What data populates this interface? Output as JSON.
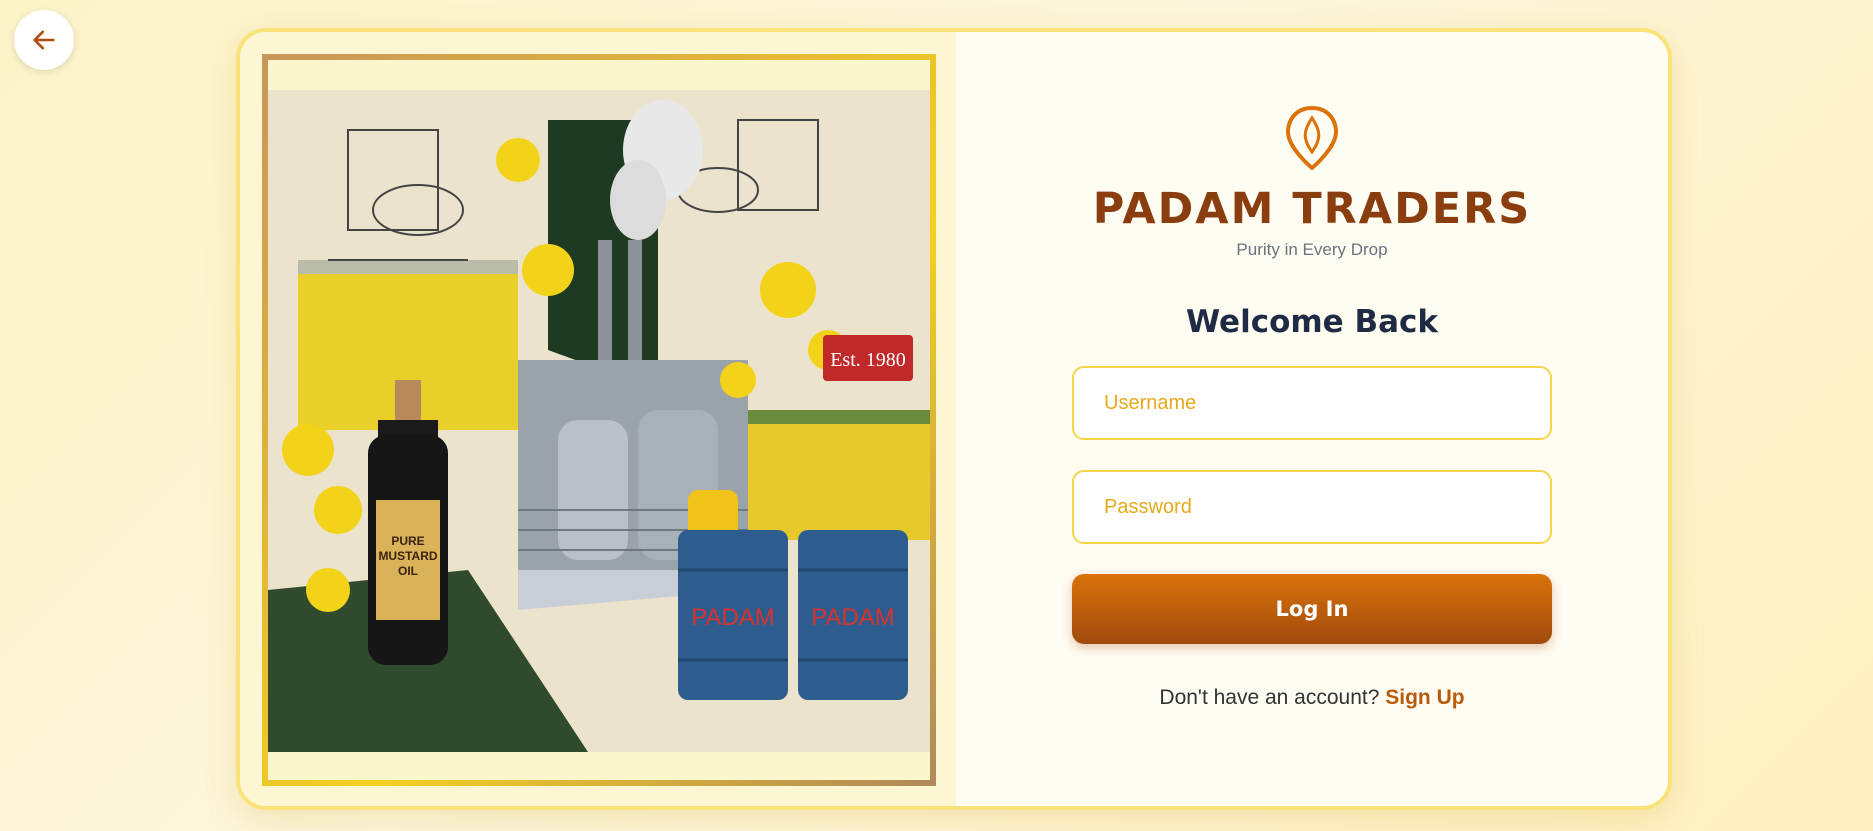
{
  "nav": {
    "back_icon": "arrow-left-icon"
  },
  "brand": {
    "logo_icon": "oil-drop-pin-icon",
    "name": "PADAM TRADERS",
    "tagline": "Purity in Every Drop"
  },
  "form": {
    "heading": "Welcome Back",
    "username_placeholder": "Username",
    "password_placeholder": "Password",
    "login_label": "Log In",
    "signup_prompt": "Don't have an account?",
    "signup_link": "Sign Up"
  },
  "hero": {
    "sign_text": "Est. 1980",
    "barrel_label": "PADAM",
    "bottle_line1": "PURE",
    "bottle_line2": "MUSTARD",
    "bottle_line3": "OIL"
  },
  "colors": {
    "accent": "#d9730a",
    "brand": "#8a3e10",
    "border": "#f5d44a",
    "heading": "#1f2a44"
  }
}
